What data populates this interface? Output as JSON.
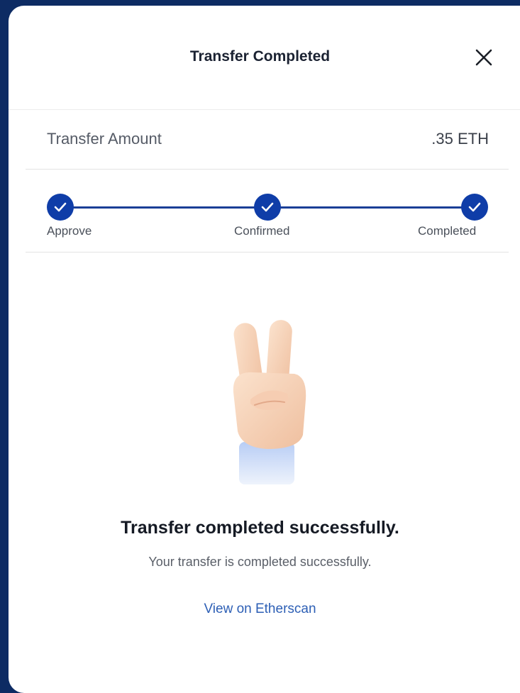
{
  "header": {
    "title": "Transfer Completed",
    "close_icon": "close-icon"
  },
  "transfer": {
    "amount_label": "Transfer Amount",
    "amount_value": ".35 ETH"
  },
  "steps": [
    {
      "label": "Approve",
      "status": "done"
    },
    {
      "label": "Confirmed",
      "status": "done"
    },
    {
      "label": "Completed",
      "status": "done"
    }
  ],
  "illustration": "peace-hand-icon",
  "result": {
    "title": "Transfer completed successfully.",
    "subtitle": "Your transfer is completed successfully.",
    "link_label": "View on Etherscan"
  },
  "colors": {
    "accent": "#0f3da8",
    "link": "#2d5fb5",
    "backdrop": "#0d2b63"
  }
}
